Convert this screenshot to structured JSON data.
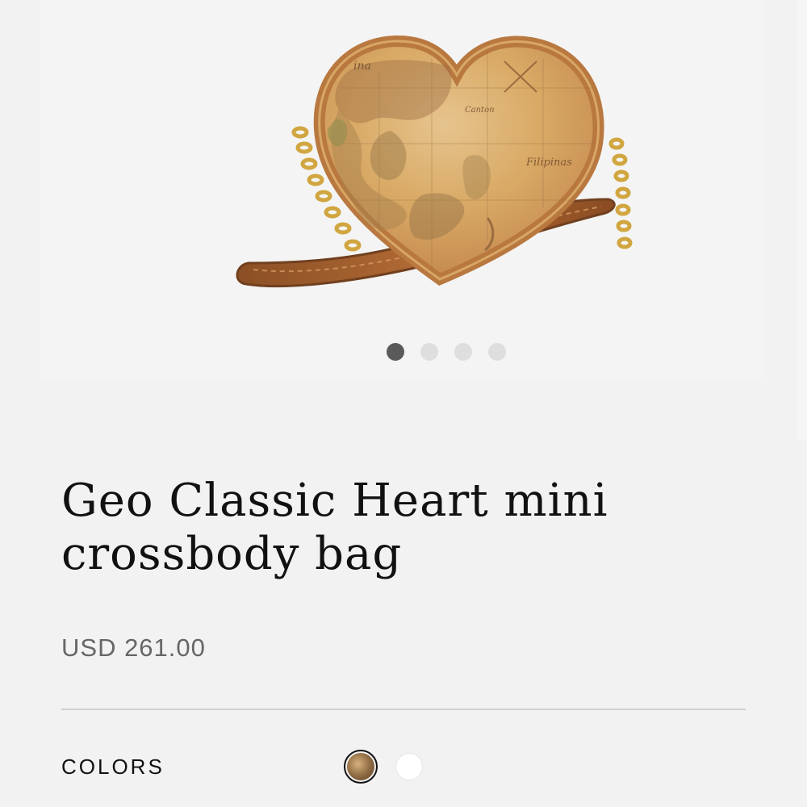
{
  "product": {
    "title": "Geo Classic Heart mini crossbody bag",
    "price": "USD 261.00",
    "image_alt": "Heart shaped crossbody bag with vintage world map print, tan leather strap and gold chain"
  },
  "gallery": {
    "slides": 4,
    "active_index": 0
  },
  "colors": {
    "label": "COLORS",
    "options": [
      {
        "name": "Geo Classic",
        "hex": "#8f6b42",
        "selected": true
      },
      {
        "name": "White",
        "hex": "#ffffff",
        "selected": false
      }
    ]
  },
  "theme": {
    "background": "#f2f2f2",
    "accent": "#111111"
  }
}
